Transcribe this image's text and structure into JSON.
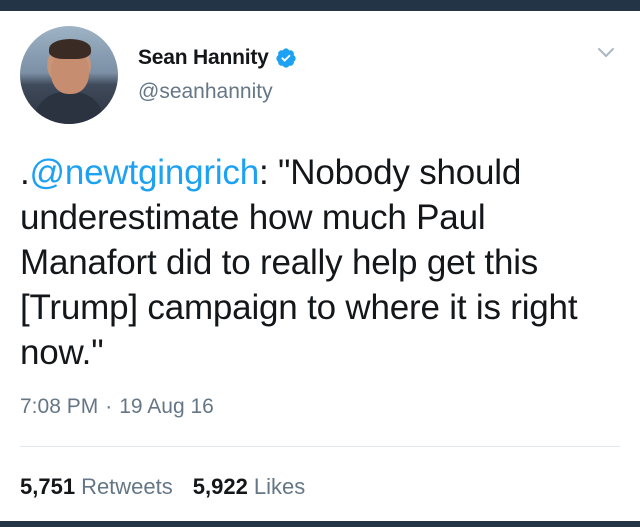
{
  "tweet": {
    "display_name": "Sean Hannity",
    "handle": "@seanhannity",
    "text_prefix": ".",
    "mention": "@newtgingrich",
    "text_body": ": \"Nobody should underestimate how much Paul Manafort did to really help get this [Trump] campaign to where it is right now.\"",
    "time": "7:08 PM",
    "separator": "·",
    "date": "19 Aug 16",
    "retweets_count": "5,751",
    "retweets_label": "Retweets",
    "likes_count": "5,922",
    "likes_label": "Likes"
  },
  "colors": {
    "accent": "#1da1f2",
    "secondary_text": "#657786",
    "primary_text": "#14171a",
    "frame": "#243447"
  },
  "icons": {
    "verified": "verified-badge-icon",
    "menu": "chevron-down-icon"
  }
}
